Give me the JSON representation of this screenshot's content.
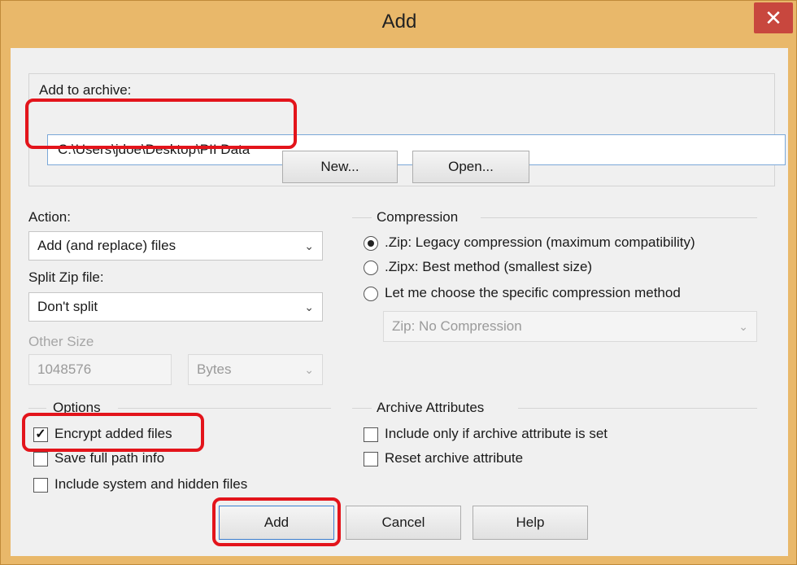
{
  "window": {
    "title": "Add",
    "close_glyph": "✕"
  },
  "archive": {
    "label": "Add to archive:",
    "path_value": "C:\\Users\\jdoe\\Desktop\\PII Data",
    "new_button": "New...",
    "open_button": "Open..."
  },
  "action": {
    "label": "Action:",
    "selected": "Add (and replace) files"
  },
  "split": {
    "label": "Split Zip file:",
    "selected": "Don't split",
    "other_size_label": "Other Size",
    "other_size_value": "1048576",
    "unit_selected": "Bytes"
  },
  "compression": {
    "label": "Compression",
    "options": [
      {
        "label": ".Zip: Legacy compression (maximum compatibility)",
        "checked": true
      },
      {
        "label": ".Zipx: Best method (smallest size)",
        "checked": false
      },
      {
        "label": "Let me choose the specific compression method",
        "checked": false
      }
    ],
    "method_selected": "Zip: No Compression"
  },
  "options": {
    "label": "Options",
    "items": [
      {
        "label": "Encrypt added files",
        "checked": true
      },
      {
        "label": "Save full path info",
        "checked": false
      },
      {
        "label": "Include system and hidden files",
        "checked": false
      }
    ]
  },
  "archive_attributes": {
    "label": "Archive Attributes",
    "items": [
      {
        "label": "Include only if archive attribute is set",
        "checked": false
      },
      {
        "label": "Reset archive attribute",
        "checked": false
      }
    ]
  },
  "buttons": {
    "add": "Add",
    "cancel": "Cancel",
    "help": "Help"
  },
  "icons": {
    "chevron": "⌄",
    "check": "✓"
  },
  "colors": {
    "window_frame": "#e9b86a",
    "close_button": "#c8473e",
    "highlight": "#e3141b",
    "input_border": "#7aa7d8"
  }
}
